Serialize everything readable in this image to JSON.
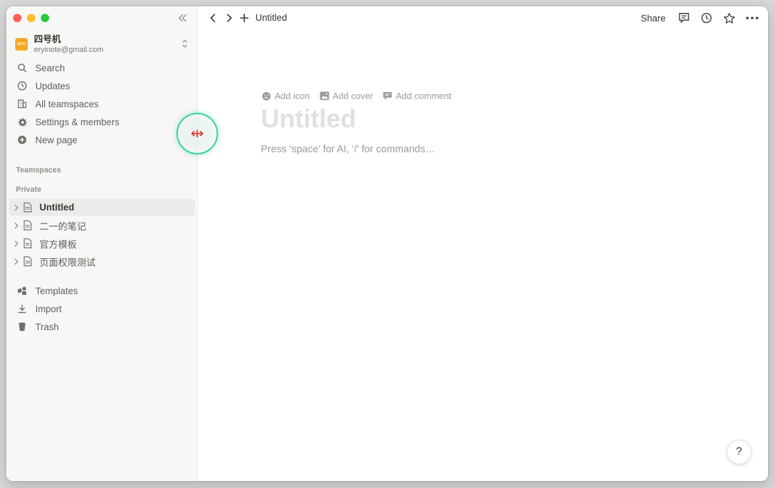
{
  "workspace": {
    "avatar_text": "ERYI",
    "name": "四号机",
    "email": "eryinote@gmail.com"
  },
  "sidebar": {
    "nav": [
      {
        "label": "Search",
        "icon": "search-icon"
      },
      {
        "label": "Updates",
        "icon": "clock-icon"
      },
      {
        "label": "All teamspaces",
        "icon": "building-icon"
      },
      {
        "label": "Settings & members",
        "icon": "gear-icon"
      },
      {
        "label": "New page",
        "icon": "plus-circle-icon"
      }
    ],
    "teamspaces_label": "Teamspaces",
    "private_label": "Private",
    "pages": [
      {
        "label": "Untitled",
        "active": true
      },
      {
        "label": "二一的笔记"
      },
      {
        "label": "官方模板"
      },
      {
        "label": "页面权限测试"
      }
    ],
    "bottom": [
      {
        "label": "Templates",
        "icon": "templates-icon"
      },
      {
        "label": "Import",
        "icon": "download-icon"
      },
      {
        "label": "Trash",
        "icon": "trash-icon"
      }
    ]
  },
  "topbar": {
    "breadcrumb": "Untitled",
    "share_label": "Share"
  },
  "editor": {
    "add_icon": "Add icon",
    "add_cover": "Add cover",
    "add_comment": "Add comment",
    "title_placeholder": "Untitled",
    "body_placeholder": "Press ‘space’ for AI, ‘/’ for commands…"
  },
  "help_label": "?",
  "colors": {
    "sidebar_bg": "#f7f7f5",
    "accent_ring": "#37d29a",
    "workspace_avatar": "#f5a623"
  }
}
